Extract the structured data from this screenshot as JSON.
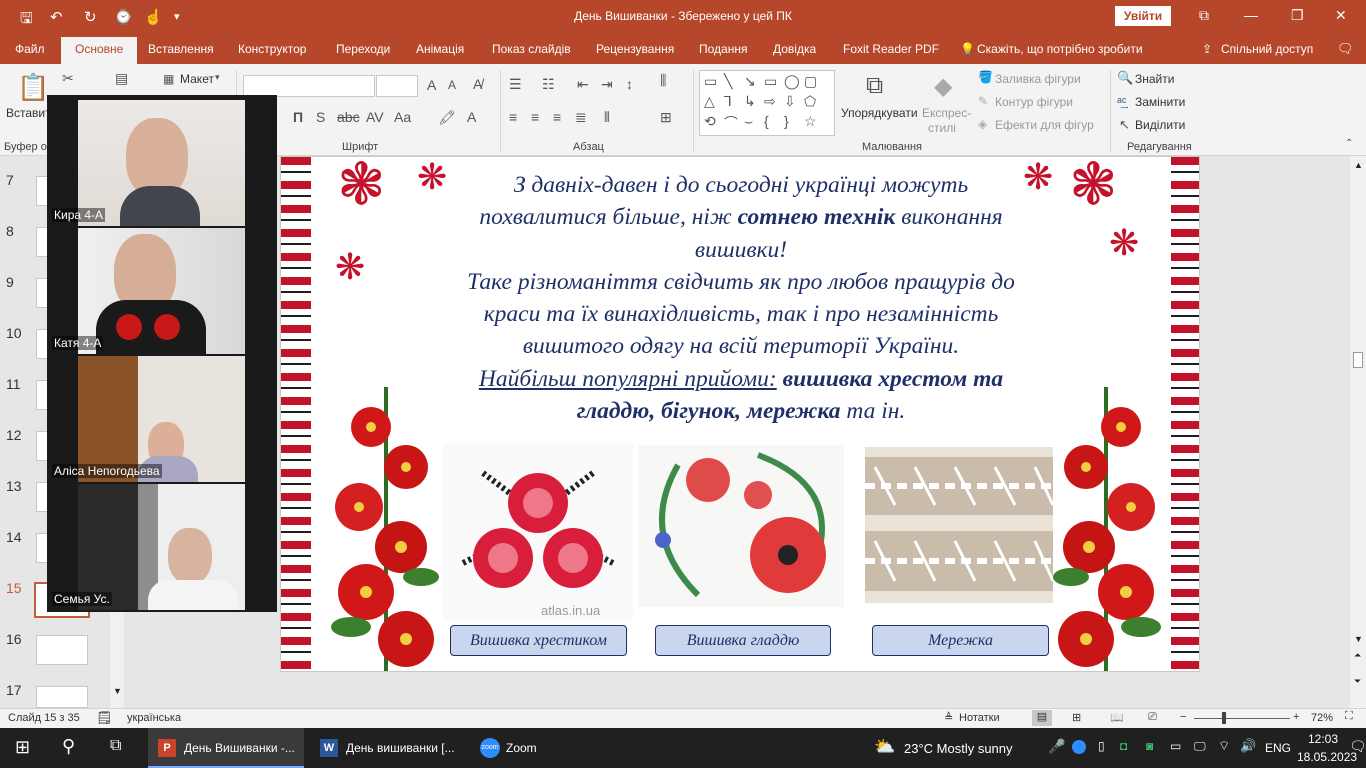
{
  "titlebar": {
    "title": "День Вишиванки  -  Збережено у цей ПК",
    "signin": "Увійти",
    "qa_save_icon": "save-icon",
    "undo_icon": "undo-icon",
    "redo_icon": "redo-icon",
    "minimize": "—",
    "restore": "❐",
    "close": "✕",
    "ribbon_display": "⧉"
  },
  "tabs": [
    {
      "label": "Файл"
    },
    {
      "label": "Основне"
    },
    {
      "label": "Вставлення"
    },
    {
      "label": "Конструктор"
    },
    {
      "label": "Переходи"
    },
    {
      "label": "Анімація"
    },
    {
      "label": "Показ слайдів"
    },
    {
      "label": "Рецензування"
    },
    {
      "label": "Подання"
    },
    {
      "label": "Довідка"
    },
    {
      "label": "Foxit Reader PDF"
    },
    {
      "label": "Скажіть, що потрібно зробити"
    },
    {
      "label": "Спільний доступ"
    }
  ],
  "ribbon": {
    "paste": "Вставити",
    "layout": "Макет",
    "clipboard_label": "Буфер о",
    "font_label": "Шрифт",
    "paragraph_label": "Абзац",
    "drawing_label": "Малювання",
    "editing_label": "Редагування",
    "arrange": "Упорядкувати",
    "quick_styles_1": "Експрес-",
    "quick_styles_2": "стилі",
    "shape_fill": "Заливка фігури",
    "shape_outline": "Контур фігури",
    "shape_effects": "Ефекти для фігур",
    "find": "Знайти",
    "replace": "Замінити",
    "select": "Виділити"
  },
  "thumbs": [
    {
      "num": "7"
    },
    {
      "num": "8"
    },
    {
      "num": "9"
    },
    {
      "num": "10"
    },
    {
      "num": "11"
    },
    {
      "num": "12"
    },
    {
      "num": "13"
    },
    {
      "num": "14"
    },
    {
      "num": "15"
    },
    {
      "num": "16"
    },
    {
      "num": "17"
    }
  ],
  "slide": {
    "line1": "З давніх-давен і до сьогодні українці можуть",
    "line2a": "похвалитися більше, ніж ",
    "line2b": "сотнею технік",
    "line2c": " виконання",
    "line3": "вишивки!",
    "line4": "Таке різноманіття свідчить як про любов пращурів до",
    "line5": "краси та їх винахідливість, так і про незамінність",
    "line6": "вишитого одягу на всій території України.",
    "line7a": "Найбільш популярні прийоми:",
    "line7b": " вишивка хрестом та",
    "line8a": "гладдю, бігунок, мережка",
    "line8b": " та ін.",
    "watermark": "atlas.in.ua",
    "captions": [
      "Вишивка хрестиком",
      "Вишивка гладдю",
      "Мережка"
    ]
  },
  "zoom": {
    "participants": [
      {
        "name": "Кира 4-А"
      },
      {
        "name": "Катя  4-А"
      },
      {
        "name": "Аліса Непогодьева"
      },
      {
        "name": "Семья Ус."
      }
    ]
  },
  "status": {
    "slide_info": "Слайд 15 з 35",
    "language": "українська",
    "notes": "Нотатки",
    "zoom_level": "72%"
  },
  "taskbar": {
    "app1": "День Вишиванки -...",
    "app2": "День вишиванки [...",
    "app3": "Zoom",
    "weather": "23°C  Mostly sunny",
    "lang": "ENG",
    "time": "12:03",
    "date": "18.05.2023"
  },
  "colors": {
    "accent": "#b7472a",
    "slide_text": "#1f3068",
    "caption_fill": "#c9d6ee",
    "ornament_red": "#c4122a"
  }
}
